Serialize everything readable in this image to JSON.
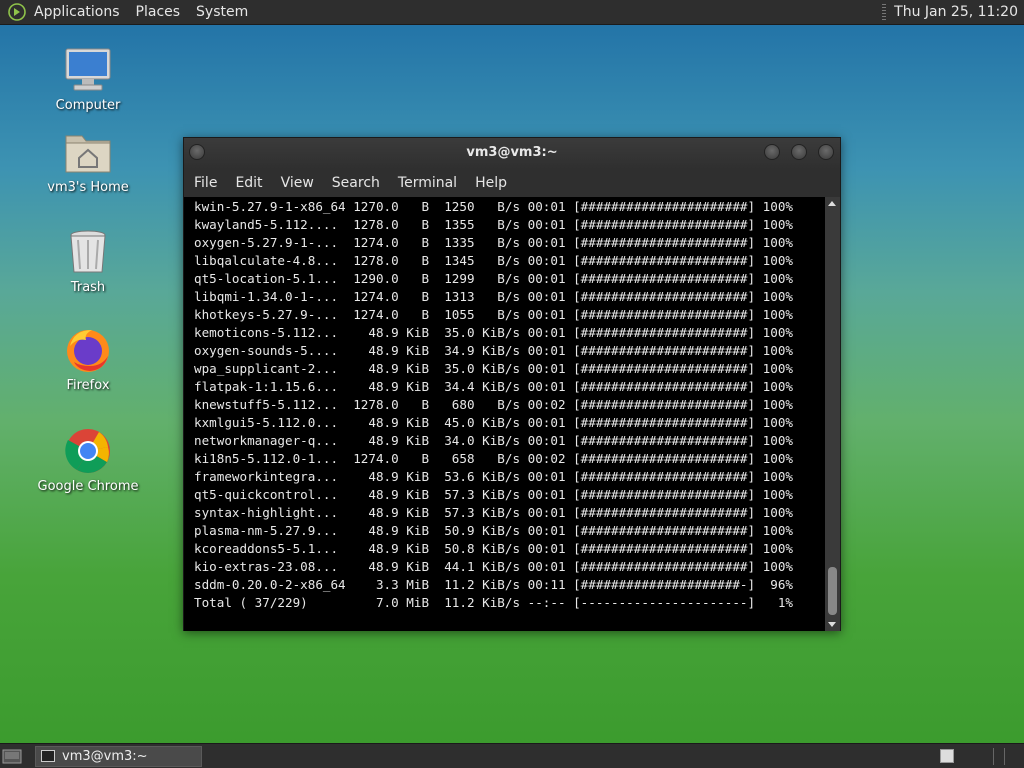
{
  "top_panel": {
    "menus": [
      "Applications",
      "Places",
      "System"
    ],
    "clock": "Thu Jan 25, 11:20"
  },
  "desktop_icons": [
    {
      "label": "Computer",
      "icon": "computer-icon"
    },
    {
      "label": "vm3's Home",
      "icon": "home-folder-icon"
    },
    {
      "label": "Trash",
      "icon": "trash-icon"
    },
    {
      "label": "Firefox",
      "icon": "firefox-icon"
    },
    {
      "label": "Google Chrome",
      "icon": "chrome-icon"
    }
  ],
  "terminal": {
    "title": "vm3@vm3:~",
    "menu": [
      "File",
      "Edit",
      "View",
      "Search",
      "Terminal",
      "Help"
    ],
    "lines": [
      "kwin-5.27.9-1-x86_64 1270.0   B  1250   B/s 00:01 [######################] 100%",
      "kwayland5-5.112....  1278.0   B  1355   B/s 00:01 [######################] 100%",
      "oxygen-5.27.9-1-...  1274.0   B  1335   B/s 00:01 [######################] 100%",
      "libqalculate-4.8...  1278.0   B  1345   B/s 00:01 [######################] 100%",
      "qt5-location-5.1...  1290.0   B  1299   B/s 00:01 [######################] 100%",
      "libqmi-1.34.0-1-...  1274.0   B  1313   B/s 00:01 [######################] 100%",
      "khotkeys-5.27.9-...  1274.0   B  1055   B/s 00:01 [######################] 100%",
      "kemoticons-5.112...    48.9 KiB  35.0 KiB/s 00:01 [######################] 100%",
      "oxygen-sounds-5....    48.9 KiB  34.9 KiB/s 00:01 [######################] 100%",
      "wpa_supplicant-2...    48.9 KiB  35.0 KiB/s 00:01 [######################] 100%",
      "flatpak-1:1.15.6...    48.9 KiB  34.4 KiB/s 00:01 [######################] 100%",
      "knewstuff5-5.112...  1278.0   B   680   B/s 00:02 [######################] 100%",
      "kxmlgui5-5.112.0...    48.9 KiB  45.0 KiB/s 00:01 [######################] 100%",
      "networkmanager-q...    48.9 KiB  34.0 KiB/s 00:01 [######################] 100%",
      "ki18n5-5.112.0-1...  1274.0   B   658   B/s 00:02 [######################] 100%",
      "frameworkintegra...    48.9 KiB  53.6 KiB/s 00:01 [######################] 100%",
      "qt5-quickcontrol...    48.9 KiB  57.3 KiB/s 00:01 [######################] 100%",
      "syntax-highlight...    48.9 KiB  57.3 KiB/s 00:01 [######################] 100%",
      "plasma-nm-5.27.9...    48.9 KiB  50.9 KiB/s 00:01 [######################] 100%",
      "kcoreaddons5-5.1...    48.9 KiB  50.8 KiB/s 00:01 [######################] 100%",
      "kio-extras-23.08...    48.9 KiB  44.1 KiB/s 00:01 [######################] 100%",
      "sddm-0.20.0-2-x86_64    3.3 MiB  11.2 KiB/s 00:11 [#####################-]  96%",
      "Total ( 37/229)         7.0 MiB  11.2 KiB/s --:-- [----------------------]   1%"
    ]
  },
  "taskbar": {
    "window_button": "vm3@vm3:~"
  }
}
